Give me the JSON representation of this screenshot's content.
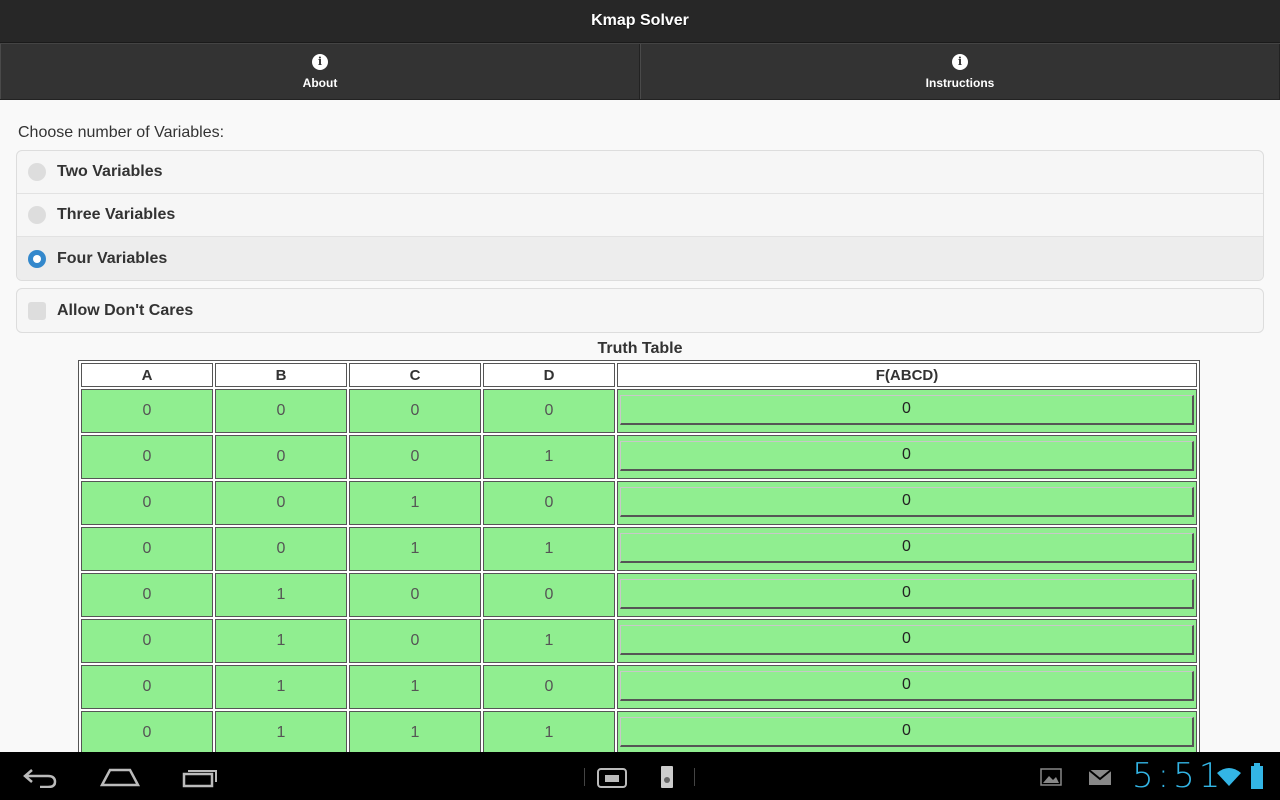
{
  "header": {
    "title": "Kmap Solver"
  },
  "navbar": [
    {
      "label": "About",
      "icon": "info-icon"
    },
    {
      "label": "Instructions",
      "icon": "info-icon"
    }
  ],
  "variables": {
    "legend": "Choose number of Variables:",
    "options": [
      "Two Variables",
      "Three Variables",
      "Four Variables"
    ],
    "selected": "Four Variables"
  },
  "dont_cares": {
    "label": "Allow Don't Cares",
    "checked": false
  },
  "truth_table": {
    "caption": "Truth Table",
    "headers": [
      "A",
      "B",
      "C",
      "D",
      "F(ABCD)"
    ],
    "rows": [
      [
        "0",
        "0",
        "0",
        "0",
        "0"
      ],
      [
        "0",
        "0",
        "0",
        "1",
        "0"
      ],
      [
        "0",
        "0",
        "1",
        "0",
        "0"
      ],
      [
        "0",
        "0",
        "1",
        "1",
        "0"
      ],
      [
        "0",
        "1",
        "0",
        "0",
        "0"
      ],
      [
        "0",
        "1",
        "0",
        "1",
        "0"
      ],
      [
        "0",
        "1",
        "1",
        "0",
        "0"
      ],
      [
        "0",
        "1",
        "1",
        "1",
        "0"
      ]
    ],
    "cell_color": "#90ee90"
  },
  "system_bar": {
    "clock": "5:51",
    "icons": [
      "back-icon",
      "home-icon",
      "recent-apps-icon",
      "screenshot-icon",
      "app-icon",
      "gallery-icon",
      "gmail-icon",
      "wifi-icon",
      "battery-icon"
    ]
  }
}
